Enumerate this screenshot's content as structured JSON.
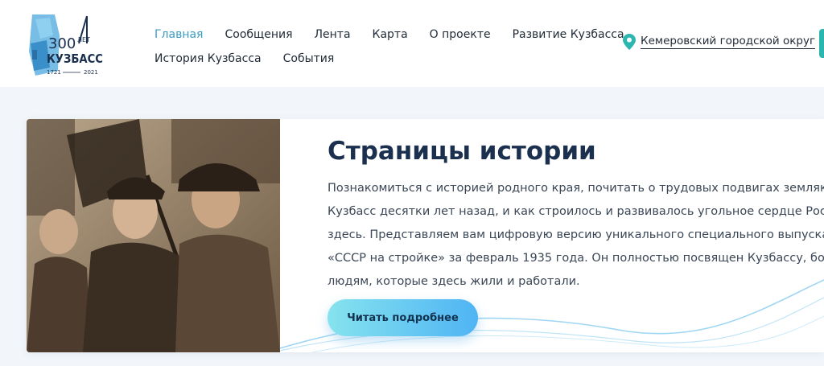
{
  "logo": {
    "number": "300",
    "years_word": "ЛЕТ",
    "name": "КУЗБАСС",
    "year_start": "1721",
    "year_end": "2021"
  },
  "nav": {
    "row1": [
      "Главная",
      "Сообщения",
      "Лента",
      "Карта",
      "О проекте",
      "Развитие Кузбасса"
    ],
    "row2": [
      "История Кузбасса",
      "События"
    ],
    "active_index": 0
  },
  "location": {
    "label": "Кемеровский городской округ",
    "icon": "map-pin-icon"
  },
  "feature": {
    "title": "Страницы истории",
    "text_lines": [
      "Познакомиться с историей родного края, почитать о трудовых подвигах земляков,",
      "Кузбасс десятки лет назад, и как строилось и развивалось угольное сердце России",
      "здесь. Представляем вам цифровую версию уникального специального выпуска",
      "«СССР на стройке» за февраль 1935 года. Он полностью посвящен Кузбассу, бол",
      "людям, которые здесь жили и работали."
    ],
    "button_label": "Читать подробнее"
  },
  "colors": {
    "accent": "#3a9cc4",
    "title": "#1b2f4e",
    "edge_tab": "#2bb7b0",
    "button_start": "#86e3ee",
    "button_end": "#4fb4f4"
  }
}
